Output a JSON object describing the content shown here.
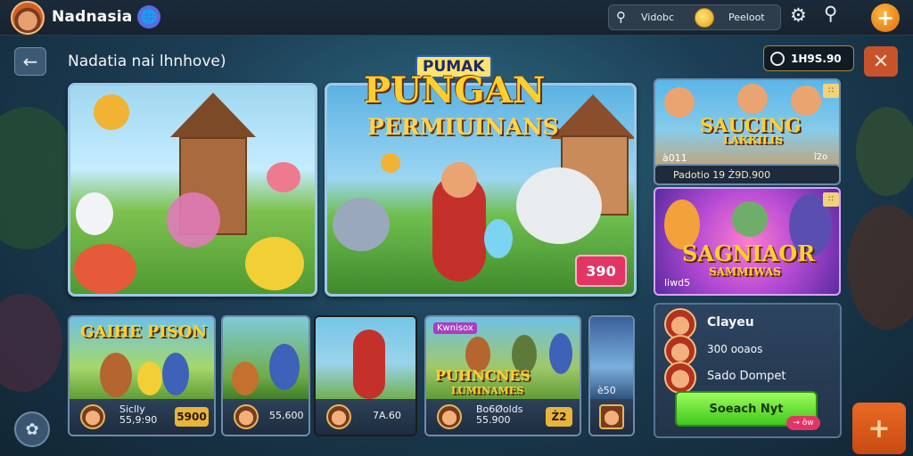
{
  "topbar": {
    "app_title": "Nadnasia",
    "globe_icon": "globe-icon",
    "search_placeholder": "Vidobc",
    "coin_label": "Peeloot",
    "settings_icon": "gear-icon",
    "search_icon": "search-icon",
    "add_icon": "plus-icon"
  },
  "header": {
    "back_icon": "arrow-left-icon",
    "section_title": "Nadatia nai lhnhove)",
    "balance": "1H9S.90",
    "close_icon": "close-icon"
  },
  "featured": {
    "promo_small": "PUMAK",
    "promo_title": "PUNGAN",
    "promo_subtitle": "PERMIUINANS",
    "price": "390"
  },
  "right_cards": [
    {
      "title": "SAUCING",
      "subtitle": "LAKKILIS",
      "badge_top": "∷",
      "number": "à011",
      "note": "î2o",
      "strip_text": "Padotio 19  Ż9D.900"
    },
    {
      "title": "SAGNIAOR",
      "subtitle": "SAMMIWAS",
      "badge_top": "∷",
      "footer": "liwd5"
    }
  ],
  "tiles": [
    {
      "title": "GAIHE PISON",
      "text": "Siclly\n55,9:90",
      "price": "5900"
    },
    {
      "title": "",
      "text": "55,600",
      "price": ""
    },
    {
      "title": "",
      "text": "7A.60",
      "price": ""
    },
    {
      "title": "PUHNCNES",
      "subtitle": "LUMINAMES",
      "label": "Kwnisox",
      "text": "Bo6Øolds\n55.900",
      "price": "Ż2"
    },
    {
      "title": "",
      "text": "è50",
      "price": ""
    }
  ],
  "side_panel": {
    "row1": "Clayeu",
    "row2": "300 ooaos",
    "row3": "Sado Dompet",
    "button_label": "Soeach Nyt",
    "tag": "→ ôw"
  },
  "colors": {
    "accent_orange": "#e06d0c",
    "price_pink": "#e23566",
    "cta_green": "#3fc91e",
    "title_gold": "#ffcf2f"
  }
}
